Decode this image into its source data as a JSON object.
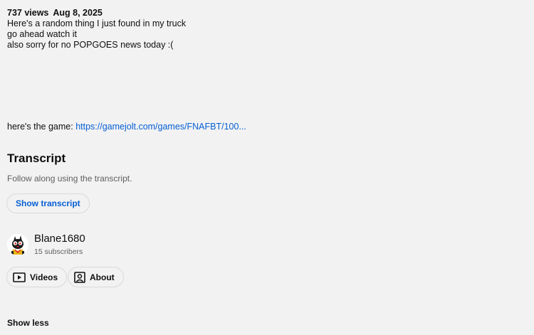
{
  "video_meta": {
    "views": "737 views",
    "date": "Aug 8, 2025"
  },
  "description": {
    "lines": [
      "Here's a random thing I just found in my truck",
      "go ahead watch it",
      "also sorry for no POPGOES news today :("
    ],
    "game_prefix": "here's the game: ",
    "game_link": "https://gamejolt.com/games/FNAFBT/100..."
  },
  "transcript": {
    "title": "Transcript",
    "subtitle": "Follow along using the transcript.",
    "button_label": "Show transcript"
  },
  "channel": {
    "name": "Blane1680",
    "subscribers": "15 subscribers",
    "avatar_icon": "character-avatar-icon"
  },
  "channel_buttons": {
    "videos_label": "Videos",
    "videos_icon": "video-play-icon",
    "about_label": "About",
    "about_icon": "person-portrait-icon"
  },
  "footer": {
    "show_less_label": "Show less"
  },
  "colors": {
    "background": "#f2f2f2",
    "link": "#065fd4",
    "secondary_text": "#606060",
    "border": "#d9d9d9"
  }
}
